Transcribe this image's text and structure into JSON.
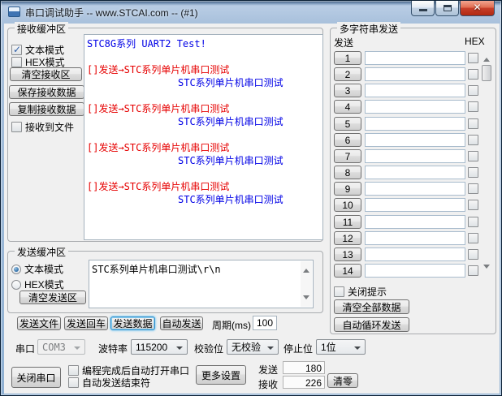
{
  "window": {
    "title": "串口调试助手 -- www.STCAI.com -- (#1)"
  },
  "receive_panel": {
    "title": "接收缓冲区",
    "text_mode_label": "文本模式",
    "hex_mode_label": "HEX模式",
    "clear_button": "清空接收区",
    "save_button": "保存接收数据",
    "copy_button": "复制接收数据",
    "to_file_label": "接收到文件",
    "lines": [
      {
        "text": "STC8G系列 UART2 Test!",
        "color": "blue",
        "indent": 0
      },
      {
        "text": "",
        "color": "blue",
        "indent": 0
      },
      {
        "text": "[]发送→STC系列单片机串口测试",
        "color": "red",
        "indent": 0
      },
      {
        "text": "STC系列单片机串口测试",
        "color": "blue",
        "indent": 1
      },
      {
        "text": "",
        "color": "blue",
        "indent": 0
      },
      {
        "text": "[]发送→STC系列单片机串口测试",
        "color": "red",
        "indent": 0
      },
      {
        "text": "STC系列单片机串口测试",
        "color": "blue",
        "indent": 1
      },
      {
        "text": "",
        "color": "blue",
        "indent": 0
      },
      {
        "text": "[]发送→STC系列单片机串口测试",
        "color": "red",
        "indent": 0
      },
      {
        "text": "STC系列单片机串口测试",
        "color": "blue",
        "indent": 1
      },
      {
        "text": "",
        "color": "blue",
        "indent": 0
      },
      {
        "text": "[]发送→STC系列单片机串口测试",
        "color": "red",
        "indent": 0
      },
      {
        "text": "STC系列单片机串口测试",
        "color": "blue",
        "indent": 1
      }
    ]
  },
  "send_panel": {
    "title": "发送缓冲区",
    "text_mode_label": "文本模式",
    "hex_mode_label": "HEX模式",
    "clear_button": "清空发送区",
    "content": "STC系列单片机串口测试\\r\\n"
  },
  "send_actions": {
    "send_file": "发送文件",
    "send_enter": "发送回车",
    "send_data": "发送数据",
    "auto_send": "自动发送",
    "period_label": "周期(ms)",
    "period_value": "100"
  },
  "serial_config": {
    "port_label": "串口",
    "port_value": "COM3",
    "baud_label": "波特率",
    "baud_value": "115200",
    "parity_label": "校验位",
    "parity_value": "无校验",
    "stop_label": "停止位",
    "stop_value": "1位"
  },
  "bottom_bar": {
    "close_port_button": "关闭串口",
    "auto_open_label": "编程完成后自动打开串口",
    "auto_terminator_label": "自动发送结束符",
    "more_settings_button": "更多设置",
    "tx_label": "发送",
    "tx_value": "180",
    "rx_label": "接收",
    "rx_value": "226",
    "clear_count_button": "清零"
  },
  "multi_send": {
    "title": "多字符串发送",
    "send_header": "发送",
    "hex_header": "HEX",
    "rows": [
      {
        "label": "1",
        "value": ""
      },
      {
        "label": "2",
        "value": ""
      },
      {
        "label": "3",
        "value": ""
      },
      {
        "label": "4",
        "value": ""
      },
      {
        "label": "5",
        "value": ""
      },
      {
        "label": "6",
        "value": ""
      },
      {
        "label": "7",
        "value": ""
      },
      {
        "label": "8",
        "value": ""
      },
      {
        "label": "9",
        "value": ""
      },
      {
        "label": "10",
        "value": ""
      },
      {
        "label": "11",
        "value": ""
      },
      {
        "label": "12",
        "value": ""
      },
      {
        "label": "13",
        "value": ""
      },
      {
        "label": "14",
        "value": ""
      }
    ],
    "close_tip_label": "关闭提示",
    "clear_all_button": "清空全部数据",
    "auto_cycle_button": "自动循环发送"
  },
  "colors": {
    "rx_sent": "#e60000",
    "rx_received": "#0000e6",
    "close_button": "#c8402b",
    "focus_ring": "#2f8bc8"
  }
}
